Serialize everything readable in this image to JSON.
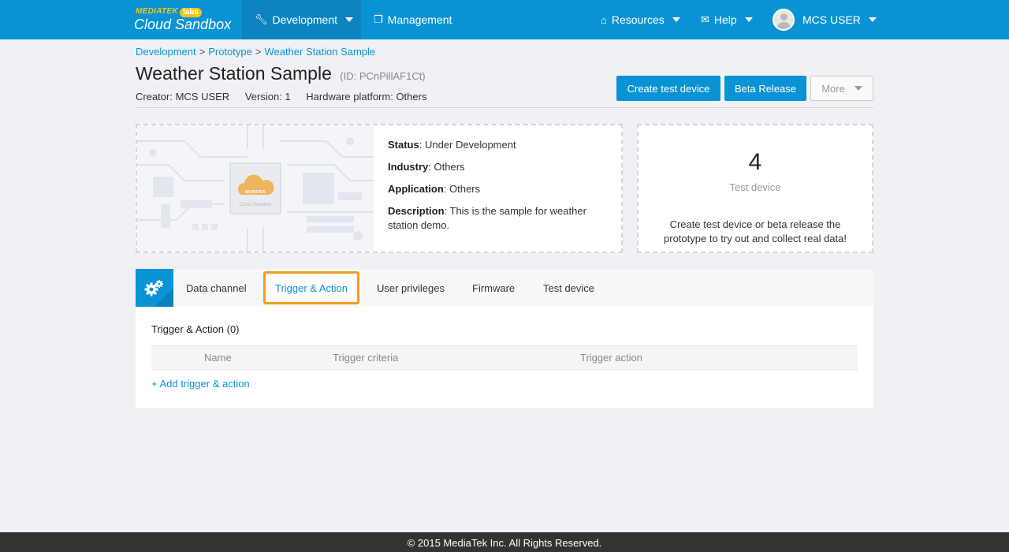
{
  "logo": {
    "brand": "MEDIATEK",
    "labs": "labs",
    "product": "Cloud Sandbox"
  },
  "nav": {
    "development": "Development",
    "management": "Management",
    "resources": "Resources",
    "help": "Help",
    "user": "MCS USER"
  },
  "breadcrumb": [
    {
      "label": "Development"
    },
    {
      "label": "Prototype"
    },
    {
      "label": "Weather Station Sample"
    }
  ],
  "breadcrumb_sep": ">",
  "page": {
    "title": "Weather Station Sample",
    "id_text": "(ID: PCnPillAF1Ct)",
    "creator": "Creator: MCS USER",
    "version": "Version: 1",
    "platform": "Hardware platform: Others"
  },
  "actions": {
    "create_test_device": "Create test device",
    "beta_release": "Beta Release",
    "more": "More"
  },
  "info": {
    "status_label": "Status",
    "status_value": ": Under Development",
    "industry_label": "Industry",
    "industry_value": ": Others",
    "application_label": "Application",
    "application_value": ": Others",
    "description_label": "Description",
    "description_value": ": This is the sample for weather station demo.",
    "board_logo": "MEDIATEK",
    "board_caption": "Cloud Sandbox"
  },
  "test_device": {
    "count": "4",
    "label": "Test device",
    "hint": "Create test device or beta release the prototype to try out and collect real data!"
  },
  "tabs": [
    {
      "label": "Data channel"
    },
    {
      "label": "Trigger & Action"
    },
    {
      "label": "User privileges"
    },
    {
      "label": "Firmware"
    },
    {
      "label": "Test device"
    }
  ],
  "trigger_panel": {
    "title": "Trigger & Action (0)",
    "columns": [
      "Name",
      "Trigger criteria",
      "Trigger action"
    ],
    "add_link": "+ Add trigger & action"
  },
  "footer": "© 2015 MediaTek Inc. All Rights Reserved.",
  "colors": {
    "brand_blue": "#0a93d4",
    "active_tab_outline": "#f39c1f",
    "footer_bg": "#34332d",
    "page_bg": "#f0f1f5"
  }
}
